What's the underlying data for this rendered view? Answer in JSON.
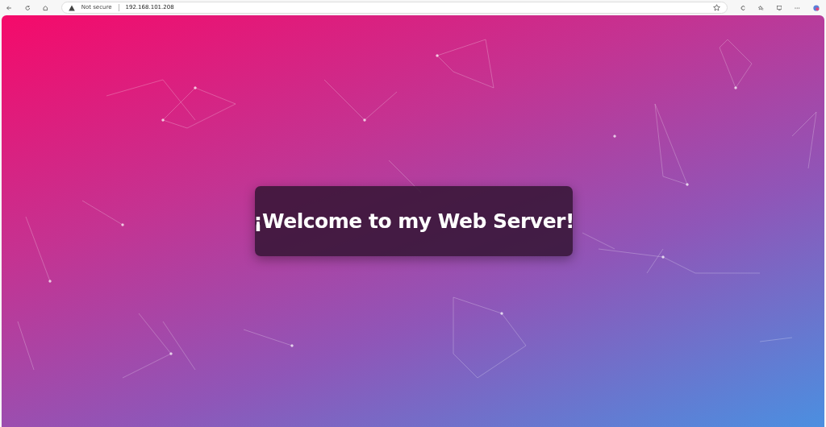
{
  "browser": {
    "security_label": "Not secure",
    "url": "192.168.101.208"
  },
  "page": {
    "heading": "¡Welcome to my Web Server!"
  }
}
